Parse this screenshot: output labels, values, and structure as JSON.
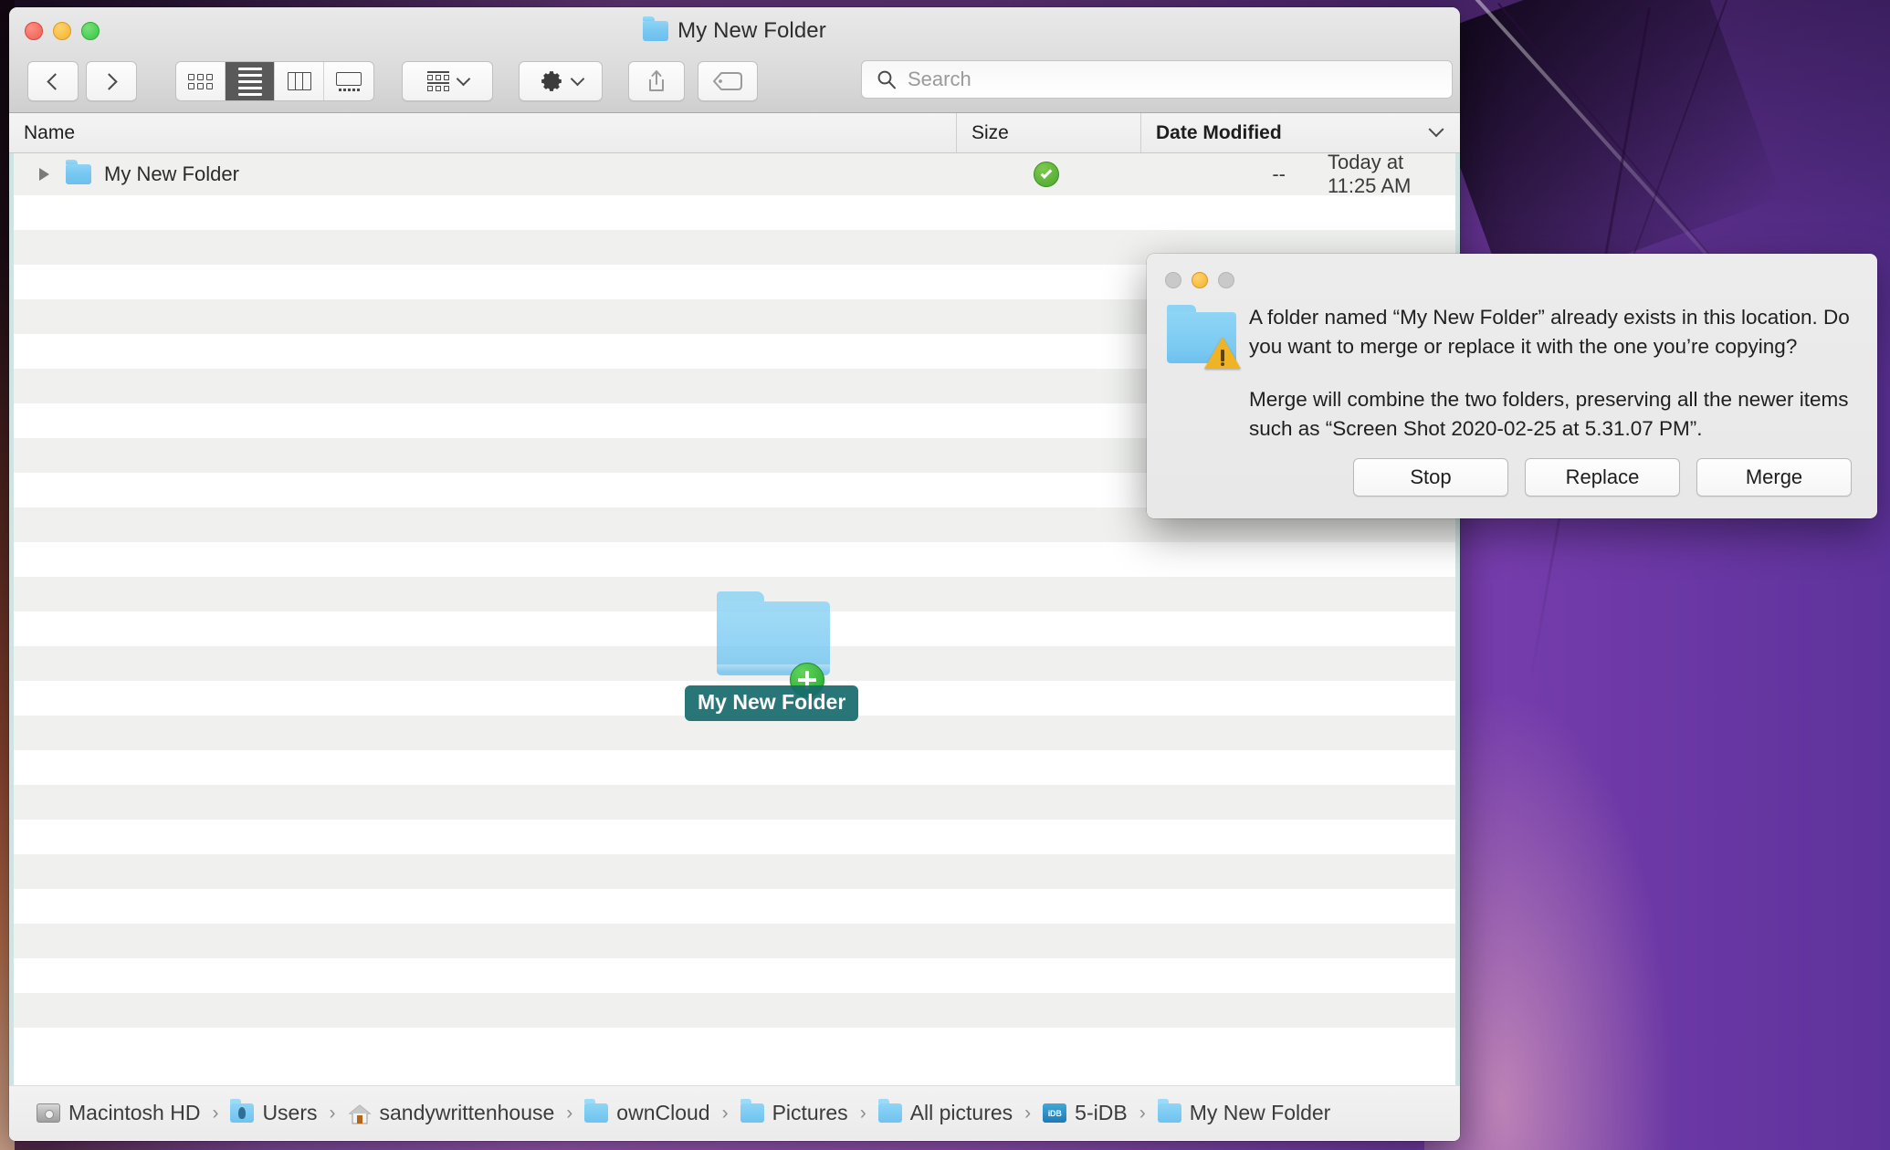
{
  "window": {
    "title": "My New Folder",
    "title_icon": "folder-icon",
    "traffic_lights": {
      "close": "close-button",
      "minimize": "minimize-button",
      "maximize": "maximize-button"
    }
  },
  "toolbar": {
    "back_label": "Back",
    "forward_label": "Forward",
    "view_modes": [
      {
        "name": "icon-view",
        "active": false
      },
      {
        "name": "list-view",
        "active": true
      },
      {
        "name": "column-view",
        "active": false
      },
      {
        "name": "gallery-view",
        "active": false
      }
    ],
    "arrange_label": "Arrange",
    "action_label": "Action",
    "share_label": "Share",
    "tag_label": "Tag"
  },
  "search": {
    "placeholder": "Search",
    "value": ""
  },
  "columns": {
    "name": "Name",
    "size": "Size",
    "date_modified": "Date Modified",
    "sorted_by": "Date Modified",
    "sort_direction": "descending"
  },
  "files": [
    {
      "name": "My New Folder",
      "icon": "folder-icon",
      "sync_status": "synced",
      "size": "--",
      "date_modified": "Today at 11:25 AM",
      "expandable": true,
      "expanded": false
    }
  ],
  "drag": {
    "label": "My New Folder",
    "badge": "copy-plus-badge",
    "icon": "folder-icon"
  },
  "path_bar": {
    "crumbs": [
      {
        "label": "Macintosh HD",
        "icon": "hard-disk-icon"
      },
      {
        "label": "Users",
        "icon": "users-folder-icon"
      },
      {
        "label": "sandywrittenhouse",
        "icon": "home-icon"
      },
      {
        "label": "ownCloud",
        "icon": "folder-icon"
      },
      {
        "label": "Pictures",
        "icon": "folder-icon"
      },
      {
        "label": "All pictures",
        "icon": "folder-icon"
      },
      {
        "label": "5-iDB",
        "icon": "idb-folder-icon",
        "icon_text": "iDB"
      },
      {
        "label": "My New Folder",
        "icon": "folder-icon"
      }
    ],
    "separator": "›"
  },
  "alert": {
    "icon": "folder-warning-icon",
    "paragraph1": "A folder named “My New Folder” already exists in this location. Do you want to merge or replace it with the one you’re copying?",
    "paragraph2": "Merge will combine the two folders, preserving all the newer items such as “Screen Shot 2020-02-25 at 5.31.07 PM”.",
    "buttons": {
      "stop": "Stop",
      "replace": "Replace",
      "merge": "Merge"
    }
  },
  "colors": {
    "accent_folder": "#79c9f2",
    "sync_green": "#4aa72b",
    "copy_green": "#22a430",
    "drop_highlight": "#cfe3e2",
    "drag_label_bg": "#166a6c",
    "warning_yellow": "#f0b323",
    "wallpaper_purple": "#9b56bd"
  }
}
